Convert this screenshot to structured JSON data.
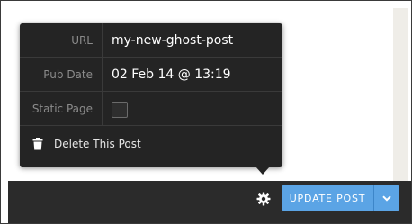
{
  "post_settings": {
    "url_label": "URL",
    "url_value": "my-new-ghost-post",
    "pub_date_label": "Pub Date",
    "pub_date_value": "02 Feb 14 @ 13:19",
    "static_page_label": "Static Page",
    "static_page_checked": false,
    "delete_label": "Delete This Post"
  },
  "footer": {
    "update_label": "UPDATE POST",
    "settings_icon": "gear-icon",
    "dropdown_icon": "chevron-down-icon"
  },
  "colors": {
    "popover_bg": "#242424",
    "footer_bg": "#2b2b2b",
    "accent_button": "#5ba4e5",
    "label_text": "#8b8b8b"
  }
}
